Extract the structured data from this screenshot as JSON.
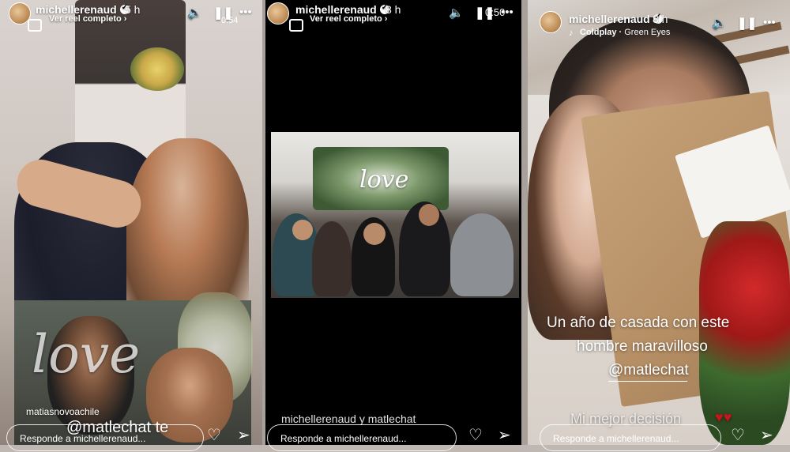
{
  "stories": [
    {
      "username": "michellerenaud",
      "time": "5 h",
      "sublink": "Ver reel completo",
      "counter": "0:54",
      "tag": "matiasnovoachile",
      "overlay_word": "love",
      "mention": "@matlechat te",
      "reply_placeholder": "Responde a michellerenaud..."
    },
    {
      "username": "michellerenaud",
      "time": "8 h",
      "sublink": "Ver reel completo",
      "counter": "0:50",
      "photo_word": "love",
      "caption": "michellerenaud y matlechat",
      "reply_placeholder": "Responde a michellerenaud..."
    },
    {
      "username": "michellerenaud",
      "time": "8 h",
      "music_artist": "Coldplay",
      "music_track": "Green Eyes",
      "text_line1": "Un año de casada con este",
      "text_line2": "hombre maravilloso",
      "mention": "@matlechat",
      "text_line3": "Mi mejor decisión",
      "hearts": "♥♥",
      "reply_placeholder": "Responde a michellerenaud..."
    }
  ],
  "icons": {
    "sound": "speaker-icon",
    "pause": "pause-icon",
    "more": "more-icon",
    "heart": "heart-icon",
    "send": "send-icon"
  }
}
